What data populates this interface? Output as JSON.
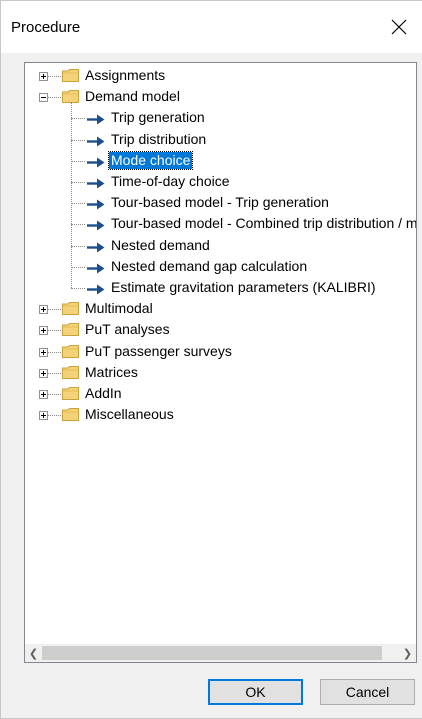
{
  "dialog": {
    "title": "Procedure"
  },
  "tree": {
    "items": [
      {
        "label": "Assignments",
        "type": "folder",
        "expanded": false
      },
      {
        "label": "Demand model",
        "type": "folder",
        "expanded": true,
        "children": [
          "Trip generation",
          "Trip distribution",
          "Mode choice",
          "Time-of-day choice",
          "Tour-based model - Trip generation",
          "Tour-based model - Combined trip distribution / mode choice",
          "Nested demand",
          "Nested demand gap calculation",
          "Estimate gravitation parameters (KALIBRI)"
        ]
      },
      {
        "label": "Multimodal",
        "type": "folder",
        "expanded": false
      },
      {
        "label": "PuT analyses",
        "type": "folder",
        "expanded": false
      },
      {
        "label": "PuT passenger surveys",
        "type": "folder",
        "expanded": false
      },
      {
        "label": "Matrices",
        "type": "folder",
        "expanded": false
      },
      {
        "label": "AddIn",
        "type": "folder",
        "expanded": false
      },
      {
        "label": "Miscellaneous",
        "type": "folder",
        "expanded": false
      }
    ],
    "selected": "Mode choice"
  },
  "buttons": {
    "ok": "OK",
    "cancel": "Cancel"
  },
  "colors": {
    "selection": "#0078d7",
    "arrow": "#1e4e8c",
    "folder": "#f3d27a"
  }
}
